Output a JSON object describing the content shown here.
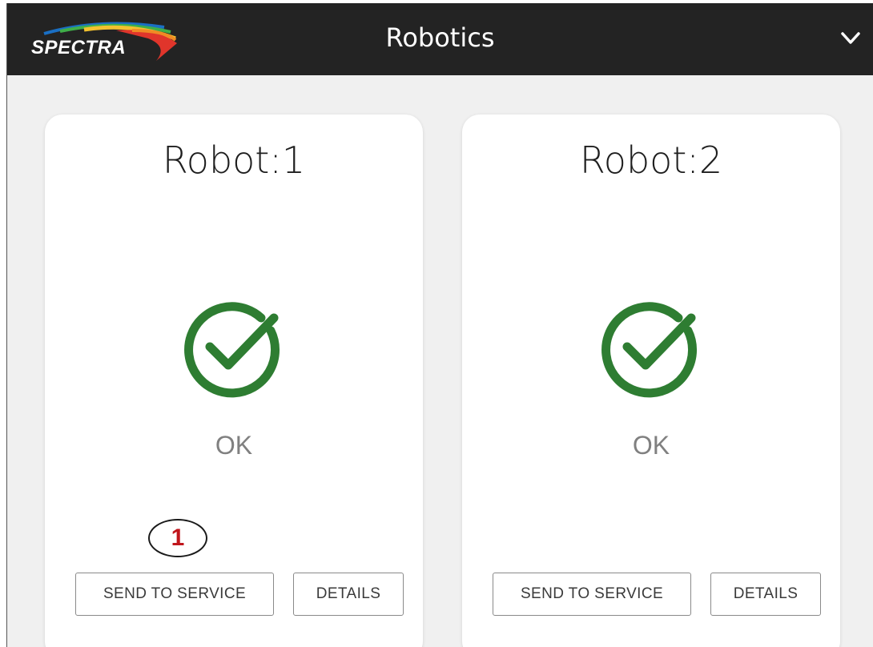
{
  "header": {
    "logo_text": "SPECTRA",
    "title": "Robotics",
    "chevron_icon": "chevron-down-icon"
  },
  "robots": [
    {
      "title": "Robot:1",
      "status_icon": "check-circle-icon",
      "status": "OK",
      "send_to_service_label": "SEND TO SERVICE",
      "details_label": "DETAILS"
    },
    {
      "title": "Robot:2",
      "status_icon": "check-circle-icon",
      "status": "OK",
      "send_to_service_label": "SEND TO SERVICE",
      "details_label": "DETAILS"
    }
  ],
  "callout": {
    "number": "1"
  },
  "colors": {
    "header_bg": "#232323",
    "status_ok": "#2e7d32",
    "callout_number": "#c0161c"
  }
}
